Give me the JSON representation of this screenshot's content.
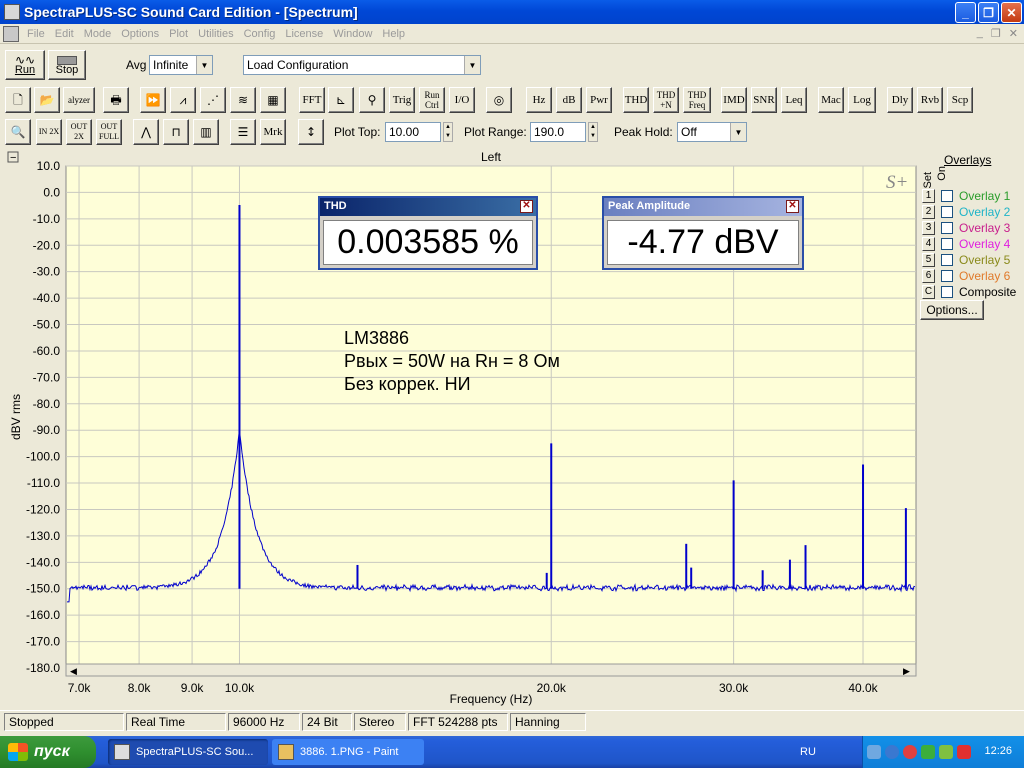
{
  "window": {
    "title": "SpectraPLUS-SC Sound Card Edition - [Spectrum]"
  },
  "menu": [
    "File",
    "Edit",
    "Mode",
    "Options",
    "Plot",
    "Utilities",
    "Config",
    "License",
    "Window",
    "Help"
  ],
  "toolbar1": {
    "run": "Run",
    "stop": "Stop",
    "avg_label": "Avg",
    "avg_value": "Infinite",
    "load_config": "Load Configuration"
  },
  "toolbar2": {
    "analyzer": "alyzer",
    "fft": "FFT",
    "trig": "Trig",
    "run_ctrl": "Run Ctrl",
    "io": "I/O",
    "hz": "Hz",
    "db": "dB",
    "pwr": "Pwr",
    "thd": "THD",
    "thdn": "THD +N",
    "thdfreq": "THD Freq",
    "imd": "IMD",
    "snr": "SNR",
    "leq": "Leq",
    "mac": "Mac",
    "log": "Log",
    "dly": "Dly",
    "rvb": "Rvb",
    "scp": "Scp"
  },
  "toolbar3": {
    "zoom_in": "IN 2X",
    "zoom_out": "OUT 2X",
    "zoom_full": "OUT FULL",
    "mrk": "Mrk",
    "plot_top_label": "Plot Top:",
    "plot_top_value": "10.00",
    "plot_range_label": "Plot Range:",
    "plot_range_value": "190.0",
    "peak_hold_label": "Peak Hold:",
    "peak_hold_value": "Off"
  },
  "plot": {
    "channel": "Left",
    "logo": "S+",
    "annotation": [
      "LM3886",
      "Рвых = 50W на Rн = 8 Ом",
      "Без коррек. НИ"
    ],
    "minus": "−",
    "plus": "+"
  },
  "thd_box": {
    "title": "THD",
    "value": "0.003585 %"
  },
  "peak_box": {
    "title": "Peak Amplitude",
    "value": "-4.77 dBV"
  },
  "overlays": {
    "title": "Overlays",
    "set_label": "Set",
    "on_label": "On",
    "items": [
      {
        "set": "1",
        "label": "Overlay 1",
        "color": "#2a9d2a"
      },
      {
        "set": "2",
        "label": "Overlay 2",
        "color": "#1fb4c8"
      },
      {
        "set": "3",
        "label": "Overlay 3",
        "color": "#c81e8c"
      },
      {
        "set": "4",
        "label": "Overlay 4",
        "color": "#e020e0"
      },
      {
        "set": "5",
        "label": "Overlay 5",
        "color": "#8a8a1a"
      },
      {
        "set": "6",
        "label": "Overlay 6",
        "color": "#e07a2a"
      },
      {
        "set": "C",
        "label": "Composite",
        "color": "#000000"
      }
    ],
    "options": "Options..."
  },
  "status": [
    "Stopped",
    "Real Time",
    "96000 Hz",
    "24 Bit",
    "Stereo",
    "FFT 524288 pts",
    "Hanning"
  ],
  "taskbar": {
    "start": "пуск",
    "task1": "SpectraPLUS-SC Sou...",
    "task2": "3886. 1.PNG - Paint",
    "lang": "RU",
    "clock": "12:26"
  },
  "chart_data": {
    "type": "line",
    "title": "",
    "xlabel": "Frequency (Hz)",
    "ylabel": "dBV rms",
    "xscale": "log",
    "xlim": [
      6800,
      45000
    ],
    "ylim": [
      -180,
      10
    ],
    "xticks": [
      {
        "v": 7000,
        "t": "7.0k"
      },
      {
        "v": 8000,
        "t": "8.0k"
      },
      {
        "v": 9000,
        "t": "9.0k"
      },
      {
        "v": 10000,
        "t": "10.0k"
      },
      {
        "v": 20000,
        "t": "20.0k"
      },
      {
        "v": 30000,
        "t": "30.0k"
      },
      {
        "v": 40000,
        "t": "40.0k"
      }
    ],
    "yticks": [
      10,
      0,
      -10,
      -20,
      -30,
      -40,
      -50,
      -60,
      -70,
      -80,
      -90,
      -100,
      -110,
      -120,
      -130,
      -140,
      -150,
      -160,
      -170,
      -180
    ],
    "grid": true,
    "color": "#0000cc",
    "noise_floor": -150,
    "peaks": [
      {
        "x": 10000,
        "y": -4.77
      },
      {
        "x": 20000,
        "y": -95
      },
      {
        "x": 30000,
        "y": -109
      },
      {
        "x": 40000,
        "y": -103
      },
      {
        "x": 44000,
        "y": -119.5
      },
      {
        "x": 27000,
        "y": -133
      },
      {
        "x": 35200,
        "y": -133.5
      },
      {
        "x": 34000,
        "y": -139
      },
      {
        "x": 13000,
        "y": -141
      },
      {
        "x": 19800,
        "y": -144
      },
      {
        "x": 27300,
        "y": -142
      },
      {
        "x": 32000,
        "y": -143
      }
    ]
  }
}
